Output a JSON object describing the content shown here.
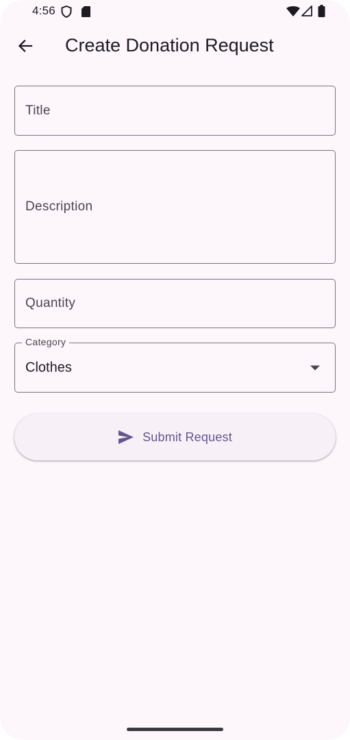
{
  "status_bar": {
    "time": "4:56",
    "icons": [
      "shield-icon",
      "sd-card-icon",
      "wifi-icon",
      "cellular-signal-icon",
      "battery-icon"
    ]
  },
  "app_bar": {
    "back_icon": "arrow-left-icon",
    "title": "Create Donation Request"
  },
  "form": {
    "title_label": "Title",
    "description_label": "Description",
    "quantity_label": "Quantity",
    "category": {
      "label": "Category",
      "value": "Clothes",
      "icon": "dropdown-arrow-icon"
    },
    "submit": {
      "icon": "send-icon",
      "label": "Submit Request"
    }
  },
  "colors": {
    "background": "#fdf7fc",
    "text_primary": "#1d1b20",
    "text_secondary": "#49454f",
    "outline": "#79747e",
    "accent": "#65558f",
    "button_surface": "#f7f1f7"
  }
}
